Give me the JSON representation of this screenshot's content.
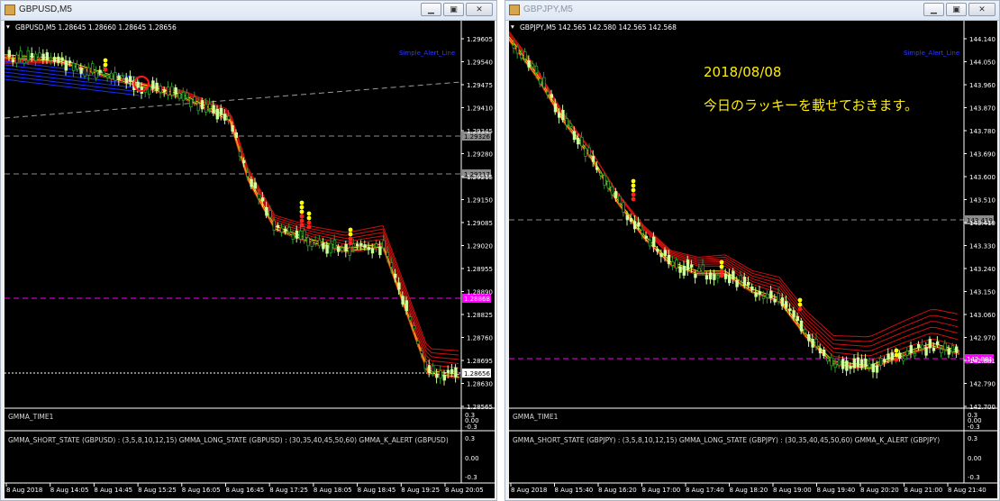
{
  "windows": [
    {
      "title": "GBPUSD,M5",
      "symbol_line": "GBPUSD,M5  1.28645 1.28660 1.28645 1.28656",
      "alert_label": "Simple_Alert_Line",
      "price_labels": [
        "1.29605",
        "1.29540",
        "1.29475",
        "1.29410",
        "1.29345",
        "1.29280",
        "1.29215",
        "1.29150",
        "1.29085",
        "1.29020",
        "1.28955",
        "1.28890",
        "1.28825",
        "1.28760",
        "1.28695",
        "1.28630",
        "1.28565"
      ],
      "marker_labels": [
        "1.29326",
        "1.29217",
        "1.28868",
        "1.28656"
      ],
      "time_labels": [
        "8 Aug 2018",
        "8 Aug 14:05",
        "8 Aug 14:45",
        "8 Aug 15:25",
        "8 Aug 16:05",
        "8 Aug 16:45",
        "8 Aug 17:25",
        "8 Aug 18:05",
        "8 Aug 18:45",
        "8 Aug 19:25",
        "8 Aug 20:05"
      ],
      "indicator1_name": "GMMA_TIME1",
      "indicator1_scale": [
        "0.3",
        "0.00",
        "-0.3"
      ],
      "indicator2_name": "GMMA_SHORT_STATE (GBPUSD) : (3,5,8,10,12,15)  GMMA_LONG_STATE (GBPUSD) : (30,35,40,45,50,60)  GMMA_K_ALERT (GBPUSD)",
      "indicator2_scale": [
        "0.3",
        "0.00",
        "-0.3"
      ]
    },
    {
      "title": "GBPJPY,M5",
      "symbol_line": "GBPJPY,M5  142.565 142.580 142.565 142.568",
      "alert_label": "Simple_Alert_Line",
      "price_labels": [
        "144.140",
        "144.050",
        "143.960",
        "143.870",
        "143.780",
        "143.690",
        "143.600",
        "143.510",
        "143.419",
        "143.330",
        "143.240",
        "143.150",
        "143.060",
        "142.970",
        "142.881",
        "142.790",
        "142.700"
      ],
      "marker_labels": [
        "143.419",
        "142.881"
      ],
      "time_labels": [
        "8 Aug 2018",
        "8 Aug 15:40",
        "8 Aug 16:20",
        "8 Aug 17:00",
        "8 Aug 17:40",
        "8 Aug 18:20",
        "8 Aug 19:00",
        "8 Aug 19:40",
        "8 Aug 20:20",
        "8 Aug 21:00",
        "8 Aug 21:40"
      ],
      "indicator1_name": "GMMA_TIME1",
      "indicator1_scale": [
        "0.3",
        "0.00",
        "-0.3"
      ],
      "indicator2_name": "GMMA_SHORT_STATE (GBPJPY) : (3,5,8,10,12,15)  GMMA_LONG_STATE (GBPJPY) : (30,35,40,45,50,60)  GMMA_K_ALERT (GBPJPY)",
      "indicator2_scale": [
        "0.3",
        "0.00",
        "-0.3"
      ],
      "overlay_date": "2018/08/08",
      "overlay_message": "今日のラッキーを載せておきます。"
    }
  ],
  "colors": {
    "bull": "#ccff99",
    "bear": "#2e9a2e",
    "ribbon": "#cc1010",
    "short_up": "#ffff00",
    "short_down": "#ff2020",
    "magenta": "#ff00ff",
    "overlay_text": "#ffee00"
  }
}
